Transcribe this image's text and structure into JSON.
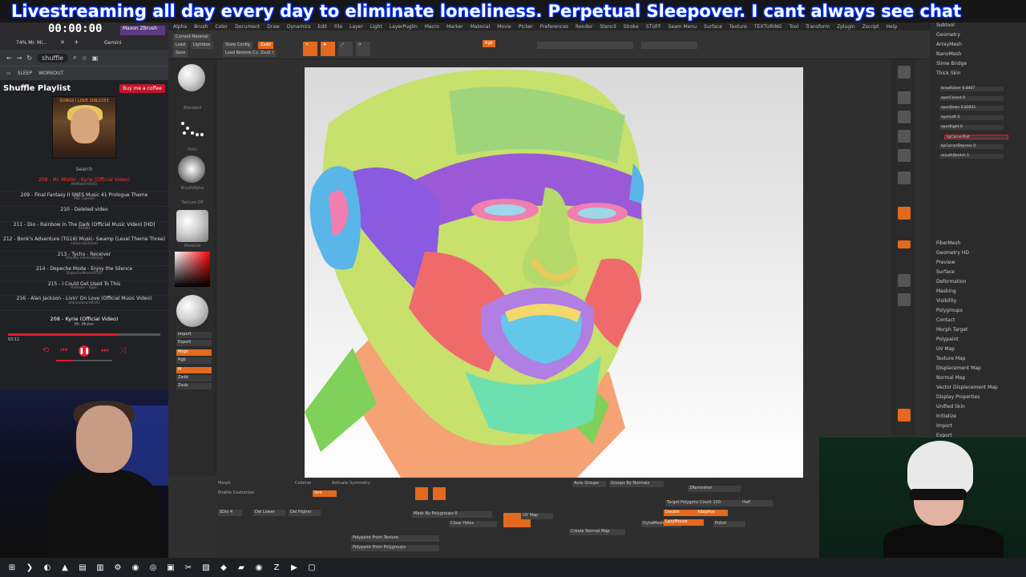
{
  "banner": {
    "text": "Livestreaming all day every day to eliminate loneliness. Perpetual Sleepover. I cant always see chat"
  },
  "browser": {
    "timer": "00:00:00",
    "tab_label": "shuffle",
    "tab_media": "74% Mr. Mi...",
    "tab_gemini": "Gemini",
    "bookmarks": [
      "SLEEP",
      "WORKOUT"
    ],
    "playlist_title": "Shuffle Playlist",
    "support_label": "Buy me a coffee",
    "art_caption": "SONGS I LOVE 208/2253",
    "search_label": "Search",
    "songs": [
      {
        "title": "208 - Mr. Mister - Kyrie (Official Video)",
        "sub": "MrMisterVEVO",
        "active": true
      },
      {
        "title": "209 - Final Fantasy II SNES Music 41 Prologue Theme",
        "sub": "PBL Games",
        "active": false
      },
      {
        "title": "210 - Deleted video",
        "sub": "",
        "active": false
      },
      {
        "title": "211 - Dio - Rainbow In The Dark (Official Music Video) [HD]",
        "sub": "RHINO",
        "active": false
      },
      {
        "title": "212 - Bonk's Adventure (TG16) Music- Swamp (Level Theme Three)",
        "sub": "classicalchanel",
        "active": false
      },
      {
        "title": "213 - Tycho - Receiver",
        "sub": "Ghostly International",
        "active": false
      },
      {
        "title": "214 - Depeche Mode - Enjoy the Silence",
        "sub": "DepecheModeVEVO",
        "active": false
      },
      {
        "title": "215 - I Could Get Used To This",
        "sub": "Release - Topic",
        "active": false
      },
      {
        "title": "216 - Alan Jackson - Livin' On Love (Official Music Video)",
        "sub": "alanjacksonVEVO",
        "active": false
      }
    ],
    "now_playing": "208 - Kyrie (Official Video)",
    "now_artist": "Mr. Mister",
    "time_elapsed": "03:11",
    "progress": 0.72,
    "volume": 0.3
  },
  "zbrush": {
    "menu": [
      "Alpha",
      "Brush",
      "Color",
      "Document",
      "Draw",
      "Dynamics",
      "Edit",
      "File",
      "Layer",
      "Light",
      "LayerPuglin",
      "Macro",
      "Marker",
      "Material",
      "Movie",
      "Picker",
      "Preferences",
      "Render",
      "Stencil",
      "Stroke",
      "STUFF",
      "Seam Menu",
      "Surface",
      "Texture",
      "TEXTURING",
      "Tool",
      "Transform",
      "Zplugin",
      "Zscript",
      "Help"
    ],
    "current_material": "Current Material",
    "top_buttons": [
      "Load",
      "Save",
      "Lightbox",
      "Store Config",
      "Load Restore Custom UI",
      "Zadd",
      "Zsub",
      "Rgb",
      "Frame",
      "Move",
      "Scale",
      "Rotate"
    ],
    "right_top": [
      "Subtool",
      "Geometry",
      "ArrayMesh",
      "NanoMesh",
      "Slime Bridge",
      "Thick Skin"
    ],
    "morph_sliders": [
      "browRaiser 0.8407",
      "eyesClosed 0",
      "eyesDown 0.82831",
      "eyesLeft 0",
      "eyesRight 0",
      "lipCornerPull",
      "lipCornerDepress 0",
      "mouthStretch 1"
    ],
    "tray_menu": [
      "FiberMesh",
      "Geometry HD",
      "Preview",
      "Surface",
      "Deformation",
      "Masking",
      "Visibility",
      "Polygroups",
      "Contact",
      "Morph Target",
      "Polypaint",
      "UV Map",
      "Texture Map",
      "Displacement Map",
      "Normal Map",
      "Vector Displacement Map",
      "Display Properties",
      "Unified Skin",
      "Initialize",
      "Import",
      "Export"
    ],
    "left_labels": [
      "Standard",
      "Dots",
      "BrushAlpha",
      "Texture Off",
      "Material"
    ],
    "left_buttons": [
      "Import",
      "Export",
      "Mrgb",
      "Rgb",
      "M",
      "Zadd",
      "Zsub"
    ],
    "bottom": {
      "morph_label": "Morph",
      "colorize_label": "Colorize",
      "activate_symmetry": "Activate Symmetry",
      "enable_customize": "Enable Customize",
      "del_lower": "Del Lower",
      "del_higher": "Del Higher",
      "smt": "Smt",
      "sdiv": "SDiv 4",
      "polypaint_from_polygroups": "Polypaint From Polygroups",
      "polypaint_from_texture": "Polypaint From Texture",
      "mask_by_polygroups": "Mask By Polygroups 0",
      "close_holes": "Close Holes",
      "auto_groups": "Auto Groups",
      "groups_by_normals": "Groups By Normals",
      "zremesher": "ZRemesher",
      "target_polygons": "Target Polygons Count 100",
      "half": "Half",
      "double": "Double",
      "adaptive": "Adaptive",
      "dynamesh": "DynaMesh",
      "create_normal_map": "Create Normal Map",
      "uv_map": "UV Map",
      "lazymouse": "LazyMouse",
      "polish": "Polish"
    }
  },
  "colors": {
    "accent": "#e2691d",
    "youtube_red": "#e21b2d",
    "banner_outline": "#0033ff"
  },
  "taskbar": {
    "icons": [
      "windows-icon",
      "copilot-icon",
      "edge-icon",
      "brave-icon",
      "explorer-icon",
      "notepad-icon",
      "settings-icon",
      "chrome-icon",
      "obs-icon",
      "pycharm-icon",
      "capture-icon",
      "photo-icon",
      "vpn-icon",
      "folder-icon",
      "chrome-icon",
      "zbrush-icon",
      "media-icon",
      "terminal-icon"
    ]
  }
}
